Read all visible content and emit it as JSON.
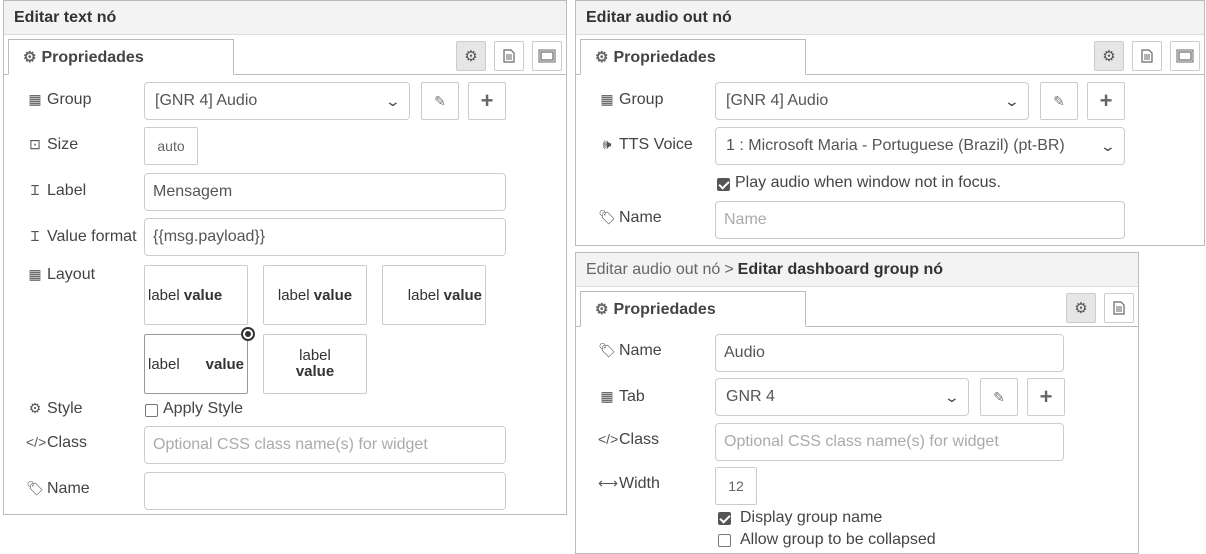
{
  "text_node": {
    "title": "Editar text nó",
    "tab_label": "Propriedades",
    "group": {
      "label": "Group",
      "value": "[GNR 4] Audio"
    },
    "size": {
      "label": "Size",
      "value": "auto"
    },
    "label_field": {
      "label": "Label",
      "value": "Mensagem"
    },
    "value_format": {
      "label": "Value format",
      "value": "{{msg.payload}}"
    },
    "layout": {
      "label": "Layout",
      "opt_label": "label",
      "opt_value": "value"
    },
    "style": {
      "label": "Style",
      "checkbox_label": "Apply Style",
      "checked": false
    },
    "class_field": {
      "label": "Class",
      "placeholder": "Optional CSS class name(s) for widget"
    },
    "name_field": {
      "label": "Name",
      "value": ""
    }
  },
  "audio_node": {
    "title": "Editar audio out nó",
    "tab_label": "Propriedades",
    "group": {
      "label": "Group",
      "value": "[GNR 4] Audio"
    },
    "tts_voice": {
      "label": "TTS Voice",
      "value": "1 : Microsoft Maria - Portuguese (Brazil) (pt-BR)"
    },
    "play_audio": {
      "label": "Play audio when window not in focus.",
      "checked": true
    },
    "name_field": {
      "label": "Name",
      "placeholder": "Name"
    }
  },
  "group_node": {
    "breadcrumb_parent": "Editar audio out nó",
    "breadcrumb_sep": ">",
    "title": "Editar dashboard group nó",
    "tab_label": "Propriedades",
    "name_field": {
      "label": "Name",
      "value": "Audio"
    },
    "tab_field": {
      "label": "Tab",
      "value": "GNR 4"
    },
    "class_field": {
      "label": "Class",
      "placeholder": "Optional CSS class name(s) for widget"
    },
    "width_field": {
      "label": "Width",
      "value": "12"
    },
    "display_group_name": {
      "label": "Display group name",
      "checked": true
    },
    "allow_collapse": {
      "label": "Allow group to be collapsed",
      "checked": false
    }
  }
}
